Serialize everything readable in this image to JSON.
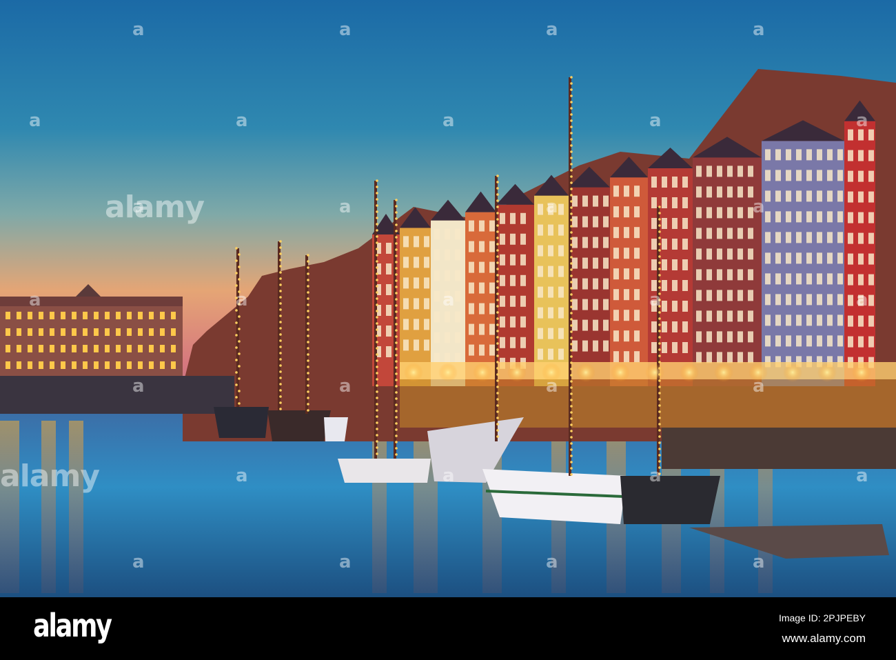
{
  "watermark": {
    "logo_text": "alamy",
    "mark": "a"
  },
  "footer": {
    "logo": "alamy",
    "image_id": "Image ID: 2PJPEBY",
    "url": "www.alamy.com"
  },
  "colors": {
    "sky_top": "#1b6aa6",
    "sky_horizon": "#f0a070",
    "water": "#2a7ab8",
    "lights": "#ffb020",
    "footer_bg": "#000000"
  }
}
